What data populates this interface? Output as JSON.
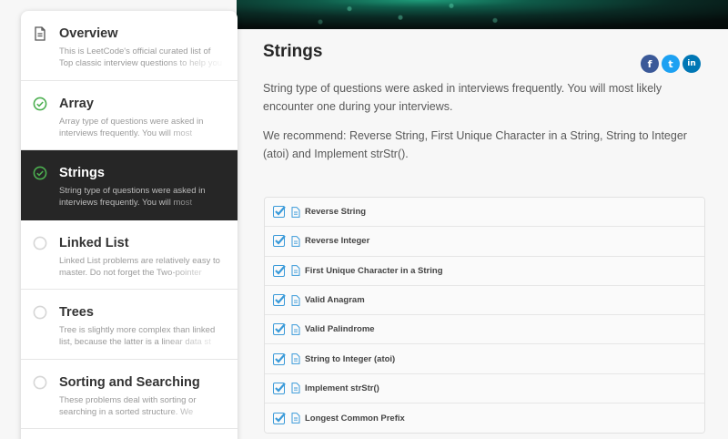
{
  "sidebar": {
    "items": [
      {
        "title": "Overview",
        "desc": "This is LeetCode's official curated list of Top classic interview questions to help you",
        "icon": "document-icon",
        "status": "info",
        "active": false
      },
      {
        "title": "Array",
        "desc": "Array type of questions were asked in interviews frequently. You will most",
        "icon": "check-circle-icon",
        "status": "complete",
        "active": false
      },
      {
        "title": "Strings",
        "desc": "String type of questions were asked in interviews frequently. You will most",
        "icon": "check-circle-icon",
        "status": "complete",
        "active": true
      },
      {
        "title": "Linked List",
        "desc": "Linked List problems are relatively easy to master. Do not forget the Two-pointer",
        "icon": "empty-circle-icon",
        "status": "incomplete",
        "active": false
      },
      {
        "title": "Trees",
        "desc": "Tree is slightly more complex than linked list, because the latter is a linear data st",
        "icon": "empty-circle-icon",
        "status": "incomplete",
        "active": false
      },
      {
        "title": "Sorting and Searching",
        "desc": "These problems deal with sorting or searching in a sorted structure. We",
        "icon": "empty-circle-icon",
        "status": "incomplete",
        "active": false
      }
    ]
  },
  "main": {
    "title": "Strings",
    "share": {
      "facebook": "f",
      "twitter": "t",
      "linkedin": "in"
    },
    "paragraph1": "String type of questions were asked in interviews frequently. You will most likely encounter one during your interviews.",
    "paragraph2": "We recommend: Reverse String, First Unique Character in a String, String to Integer (atoi) and Implement strStr().",
    "questions": [
      "Reverse String",
      "Reverse Integer",
      "First Unique Character in a String",
      "Valid Anagram",
      "Valid Palindrome",
      "String to Integer (atoi)",
      "Implement strStr()",
      "Longest Common Prefix"
    ]
  },
  "colors": {
    "complete": "#4caf50",
    "incomplete": "#d6d6d6",
    "active_bg": "#262626",
    "checkbox": "#3a9ad9",
    "facebook": "#3b5998",
    "twitter": "#1da1f2",
    "linkedin": "#0077b5"
  }
}
